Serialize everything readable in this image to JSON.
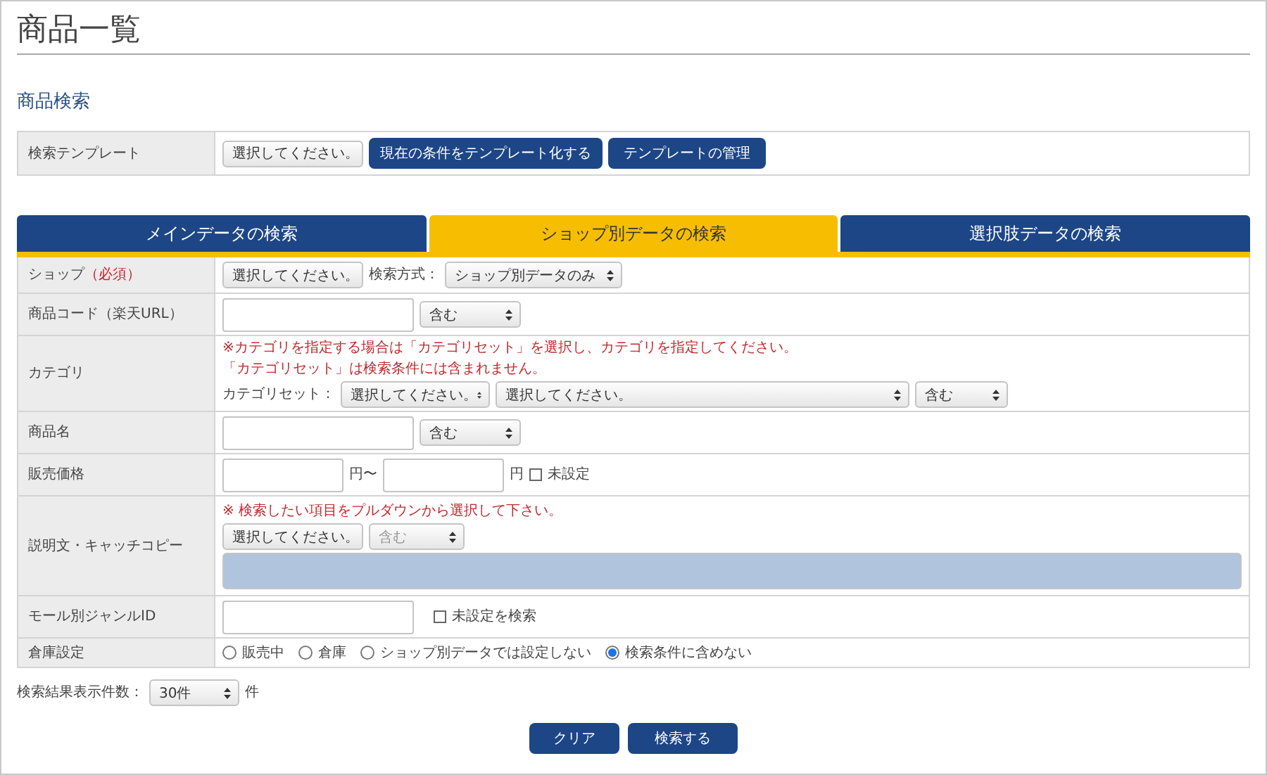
{
  "page_title": "商品一覧",
  "section_title": "商品検索",
  "template": {
    "label": "検索テンプレート",
    "select": "選択してください。",
    "buttons": [
      "現在の条件をテンプレート化する",
      "テンプレートの管理"
    ]
  },
  "tabs": [
    {
      "label": "メインデータの検索",
      "selected": false
    },
    {
      "label": "ショップ別データの検索",
      "selected": true
    },
    {
      "label": "選択肢データの検索",
      "selected": false
    }
  ],
  "rows": [
    {
      "kind": "shop",
      "label": "ショップ",
      "required": "（必須）",
      "select": "選択してください。",
      "method_label": "検索方式：",
      "method_select": "ショップ別データのみ"
    },
    {
      "kind": "text_match",
      "label": "商品コード（楽天URL）",
      "match": "含む"
    },
    {
      "kind": "category",
      "label": "カテゴリ",
      "notes": [
        "※カテゴリを指定する場合は「カテゴリセット」を選択し、カテゴリを指定してください。",
        "「カテゴリセット」は検索条件には含まれません。"
      ],
      "set_label": "カテゴリセット：",
      "set_select": "選択してください。",
      "category_select": "選択してください。",
      "match": "含む"
    },
    {
      "kind": "text_match",
      "label": "商品名",
      "match": "含む"
    },
    {
      "kind": "price",
      "label": "販売価格",
      "unit_from": "円〜",
      "unit_to": "円",
      "checkbox": {
        "label": "未設定",
        "checked": false
      }
    },
    {
      "kind": "description",
      "label": "説明文・キャッチコピー",
      "note": "※ 検索したい項目をプルダウンから選択して下さい。",
      "selects": [
        {
          "value": "選択してください。",
          "disabled": false
        },
        {
          "value": "含む",
          "disabled": true
        }
      ]
    },
    {
      "kind": "genre",
      "label": "モール別ジャンルID",
      "checkbox": {
        "label": "未設定を検索",
        "checked": false
      }
    },
    {
      "kind": "radios",
      "label": "倉庫設定",
      "options": [
        {
          "label": "販売中",
          "selected": false
        },
        {
          "label": "倉庫",
          "selected": false
        },
        {
          "label": "ショップ別データでは設定しない",
          "selected": false
        },
        {
          "label": "検索条件に含めない",
          "selected": true
        }
      ]
    }
  ],
  "result_count": {
    "label": "検索結果表示件数：",
    "select": "30件",
    "suffix": "件"
  },
  "actions": [
    "クリア",
    "検索する"
  ]
}
